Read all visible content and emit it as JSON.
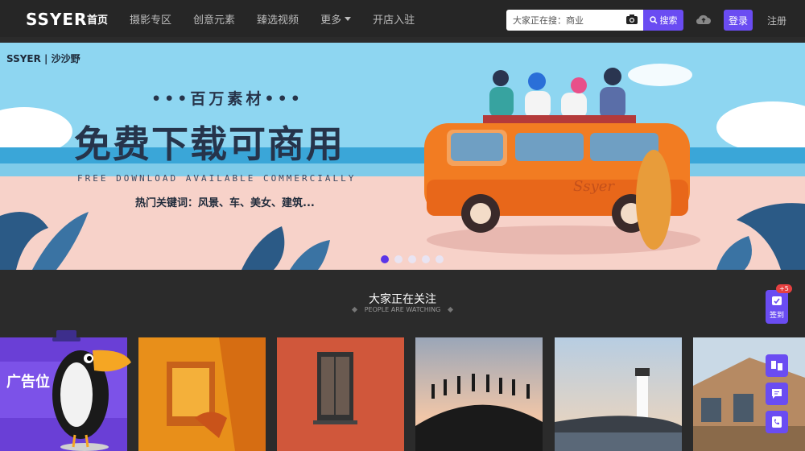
{
  "header": {
    "logo": "SSYER",
    "nav": [
      {
        "label": "首页",
        "active": true
      },
      {
        "label": "摄影专区"
      },
      {
        "label": "创意元素"
      },
      {
        "label": "臻选视频"
      },
      {
        "label": "更多"
      },
      {
        "label": "开店入驻"
      }
    ],
    "search_placeholder": "大家正在搜：商业",
    "search_button": "搜索",
    "login": "登录",
    "register": "注册"
  },
  "banner": {
    "brand": "SSYER | 沙沙野",
    "tagline": "•••百万素材•••",
    "headline": "免费下载可商用",
    "subline": "FREE DOWNLOAD AVAILABLE COMMERCIALLY",
    "hot_keywords": "热门关键词：风景、车、美女、建筑...",
    "van_text": "Ssyer",
    "slides": 5,
    "active_slide": 0
  },
  "section": {
    "title": "大家正在关注",
    "subtitle": "PEOPLE ARE WATCHING"
  },
  "thumbnails": [
    {
      "name": "ad-promo"
    },
    {
      "name": "orange-architecture"
    },
    {
      "name": "red-wall-window"
    },
    {
      "name": "people-silhouettes-jumping"
    },
    {
      "name": "lighthouse-sunset"
    },
    {
      "name": "wooden-house"
    }
  ],
  "mascot_text": "广告位",
  "side": {
    "sign_label": "签到",
    "sign_badge": "+5"
  },
  "colors": {
    "accent": "#6a4cf2",
    "nav_bg": "#262626",
    "page_bg": "#2b2b2b"
  }
}
